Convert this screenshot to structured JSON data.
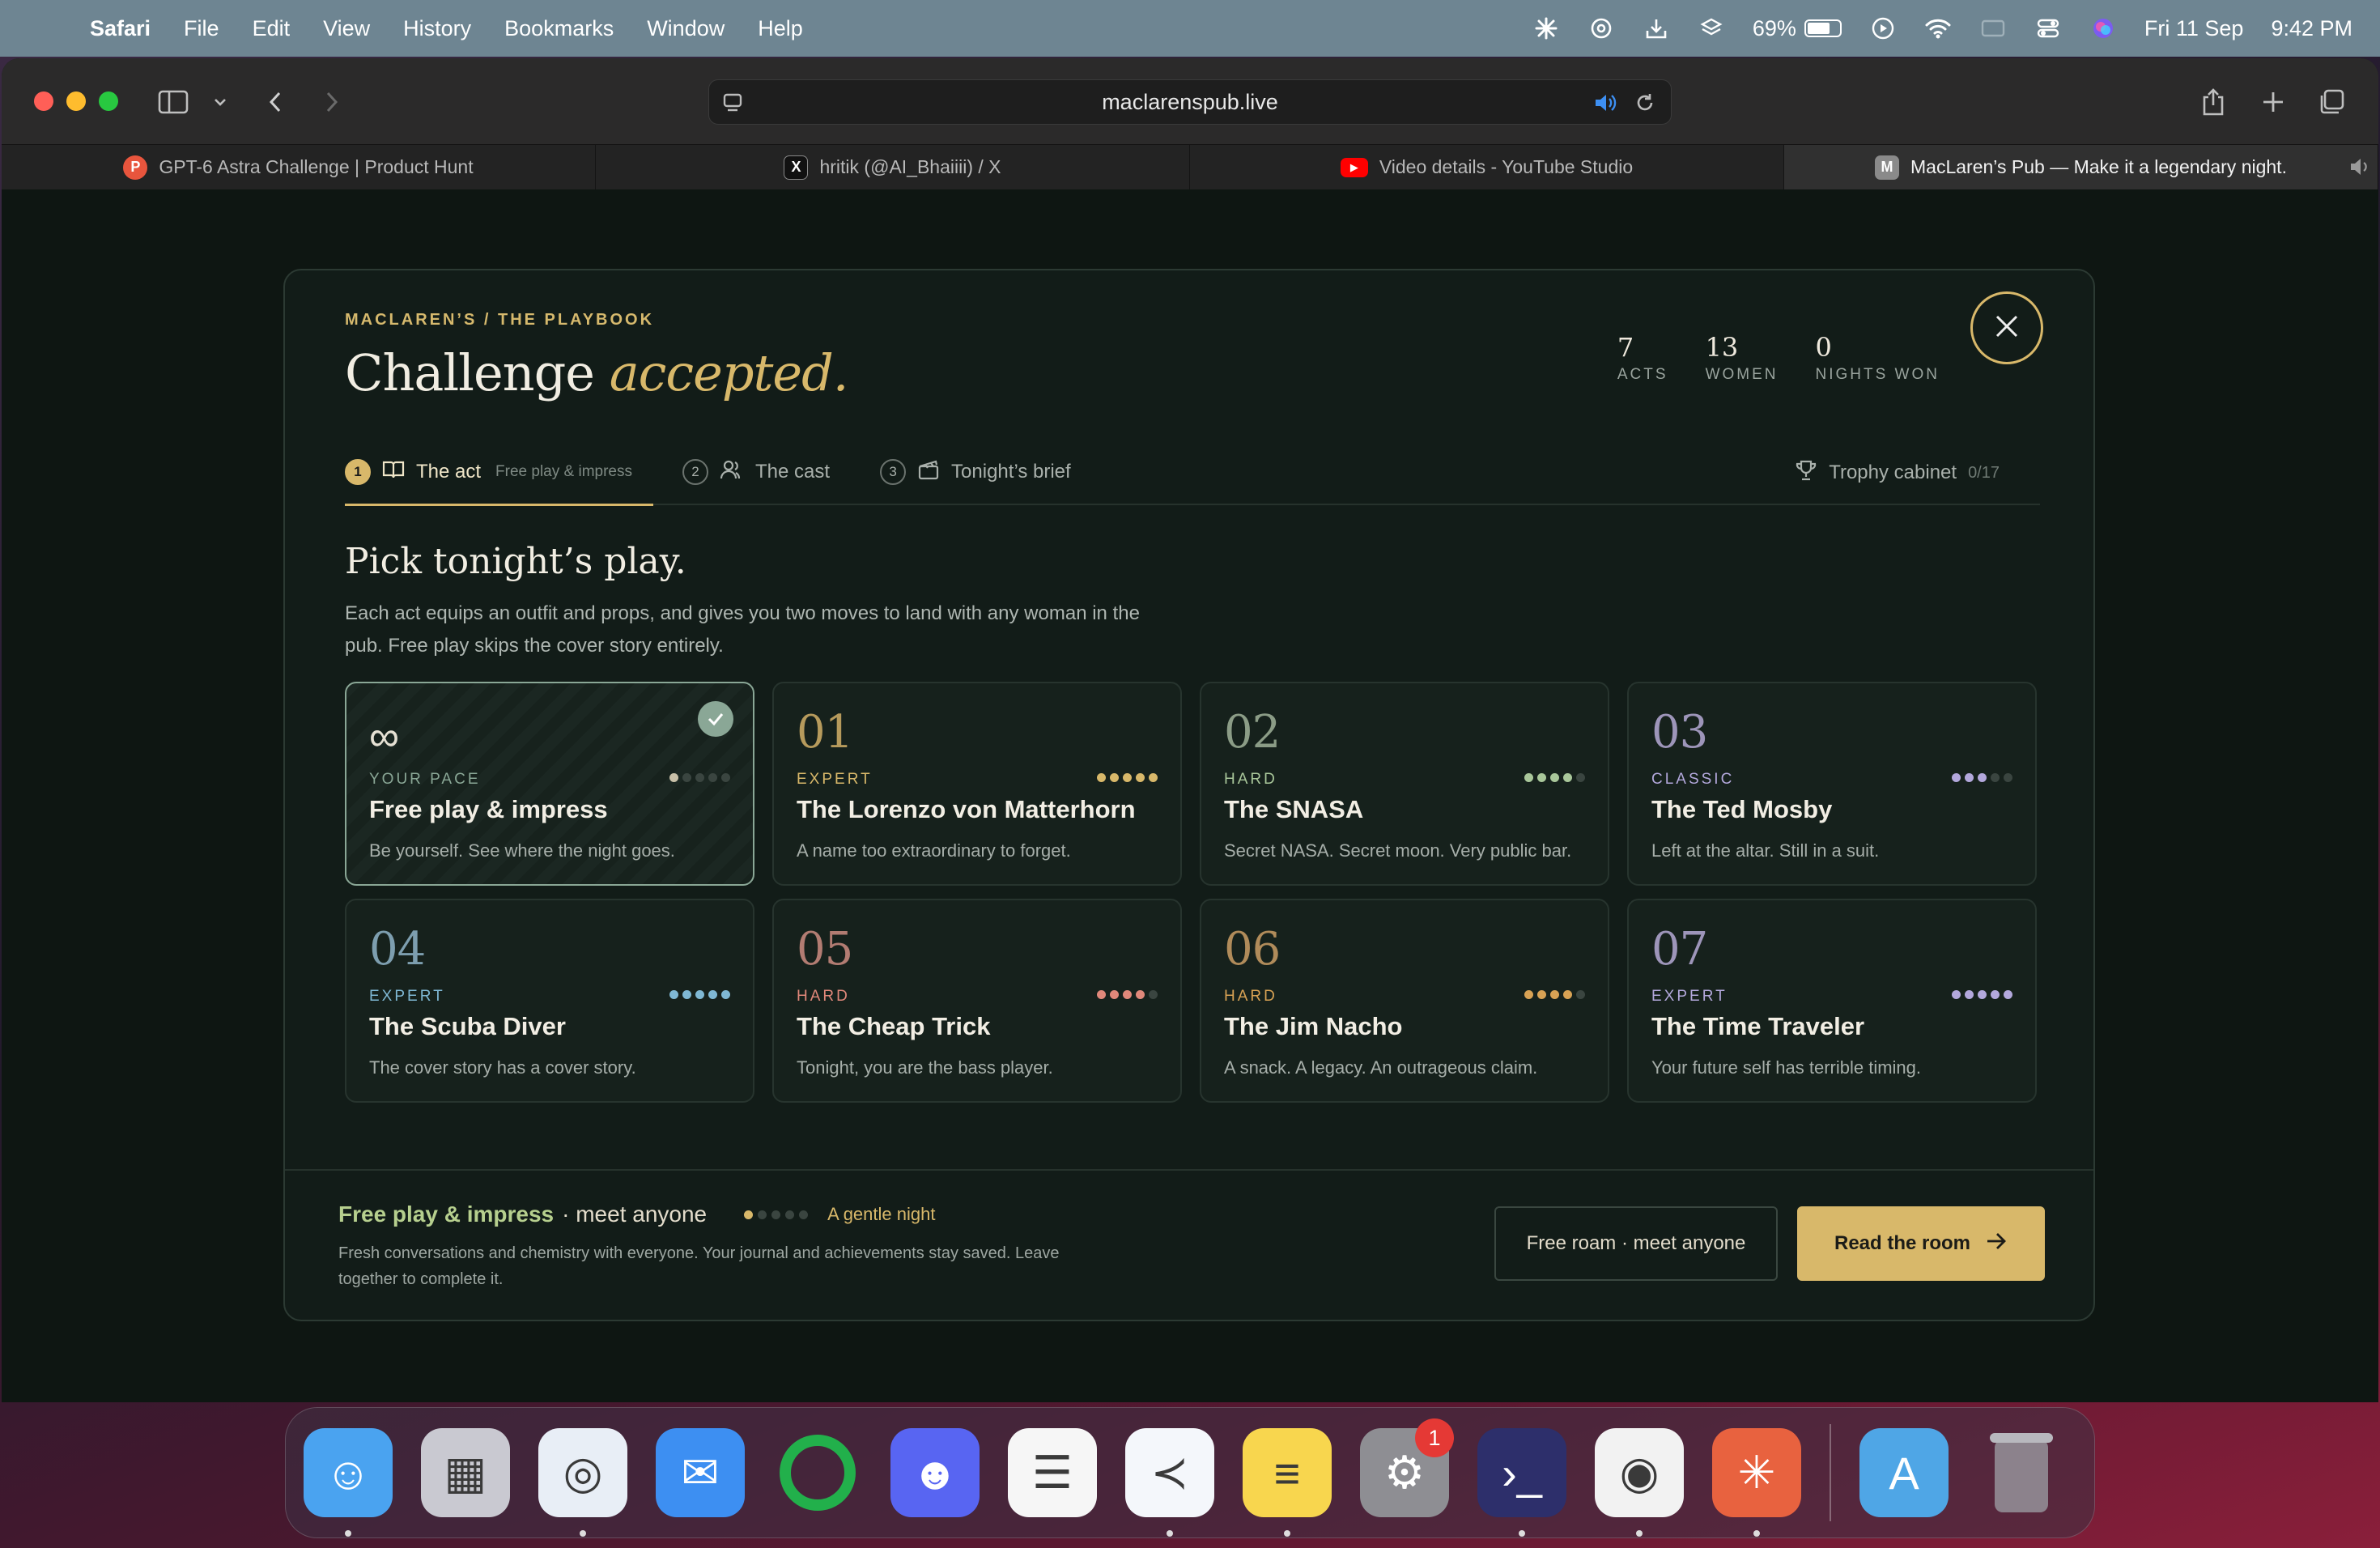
{
  "menubar": {
    "app": "Safari",
    "items": [
      "File",
      "Edit",
      "View",
      "History",
      "Bookmarks",
      "Window",
      "Help"
    ],
    "battery": "69%",
    "date": "Fri 11 Sep",
    "time": "9:42 PM"
  },
  "browser": {
    "url": "maclarenspub.live",
    "tabs": [
      {
        "label": "GPT-6 Astra Challenge | Product Hunt",
        "icon": "producthunt-icon",
        "icon_text": "P",
        "color": "#e8553d"
      },
      {
        "label": "hritik (@AI_Bhaiiii) / X",
        "icon": "x-icon",
        "icon_text": "X",
        "color": "#111111"
      },
      {
        "label": "Video details - YouTube Studio",
        "icon": "youtube-icon",
        "icon_text": "▶",
        "color": "#ff0000"
      },
      {
        "label": "MacLaren’s Pub — Make it a legendary night.",
        "icon": "maclarens-icon",
        "icon_text": "M",
        "color": "#8a8a8a"
      }
    ]
  },
  "modal": {
    "kicker": "MACLAREN’S / THE PLAYBOOK",
    "title_plain": "Challenge",
    "title_em": "accepted.",
    "stats": [
      {
        "value": "7",
        "label": "ACTS"
      },
      {
        "value": "13",
        "label": "WOMEN"
      },
      {
        "value": "0",
        "label": "NIGHTS WON"
      }
    ],
    "steps": [
      {
        "num": "1",
        "label": "The act",
        "sub": "Free play & impress"
      },
      {
        "num": "2",
        "label": "The cast",
        "sub": ""
      },
      {
        "num": "3",
        "label": "Tonight’s brief",
        "sub": ""
      }
    ],
    "trophy": {
      "label": "Trophy cabinet",
      "count": "0/17"
    },
    "heading": "Pick tonight’s play.",
    "description": "Each act equips an outfit and props, and gives you two moves to land with any woman in the pub. Free play skips the cover story entirely.",
    "cards": [
      {
        "num": "∞",
        "difficulty": "YOUR PACE",
        "name": "Free play & impress",
        "desc": "Be yourself. See where the night goes.",
        "level": 1,
        "color": "#8aa796",
        "num_color": "#e6e1d4",
        "selected": true
      },
      {
        "num": "01",
        "difficulty": "EXPERT",
        "name": "The Lorenzo von Matterhorn",
        "desc": "A name too extraordinary to forget.",
        "level": 5,
        "color": "#d8b86a",
        "num_color": "#b69a5c"
      },
      {
        "num": "02",
        "difficulty": "HARD",
        "name": "The SNASA",
        "desc": "Secret NASA. Secret moon. Very public bar.",
        "level": 4,
        "color": "#a9c79a",
        "num_color": "#8b9c86"
      },
      {
        "num": "03",
        "difficulty": "CLASSIC",
        "name": "The Ted Mosby",
        "desc": "Left at the altar. Still in a suit.",
        "level": 3,
        "color": "#b3a8dc",
        "num_color": "#9d95b9"
      },
      {
        "num": "04",
        "difficulty": "EXPERT",
        "name": "The Scuba Diver",
        "desc": "The cover story has a cover story.",
        "level": 5,
        "color": "#7fb8d4",
        "num_color": "#7d9eaf"
      },
      {
        "num": "05",
        "difficulty": "HARD",
        "name": "The Cheap Trick",
        "desc": "Tonight, you are the bass player.",
        "level": 4,
        "color": "#e0887a",
        "num_color": "#b27c72"
      },
      {
        "num": "06",
        "difficulty": "HARD",
        "name": "The Jim Nacho",
        "desc": "A snack. A legacy. An outrageous claim.",
        "level": 4,
        "color": "#d8a254",
        "num_color": "#b08b5a"
      },
      {
        "num": "07",
        "difficulty": "EXPERT",
        "name": "The Time Traveler",
        "desc": "Your future self has terrible timing.",
        "level": 5,
        "color": "#b3a8dc",
        "num_color": "#9d95b9"
      }
    ],
    "footer": {
      "title": "Free play & impress",
      "suffix": "· meet anyone",
      "mood": "A gentle night",
      "level": 1,
      "desc": "Fresh conversations and chemistry with everyone. Your journal and achievements stay saved. Leave together to complete it.",
      "ghost_btn": "Free roam · meet anyone",
      "primary_btn": "Read the room"
    }
  },
  "dock": {
    "apps": [
      {
        "name": "finder-icon",
        "bg": "#4aa3f0",
        "glyph": "☺",
        "running": true
      },
      {
        "name": "launchpad-icon",
        "bg": "#c9c9d1",
        "glyph": "▦",
        "running": false
      },
      {
        "name": "safari-icon",
        "bg": "#e8eef6",
        "glyph": "◎",
        "running": true
      },
      {
        "name": "mail-icon",
        "bg": "#3d8ff2",
        "glyph": "✉",
        "running": false
      },
      {
        "name": "activity-ring-icon",
        "bg": "transparent",
        "glyph": "◯",
        "running": false
      },
      {
        "name": "discord-icon",
        "bg": "#5865f2",
        "glyph": "☻",
        "running": false
      },
      {
        "name": "reminders-icon",
        "bg": "#f6f6f6",
        "glyph": "☰",
        "running": false
      },
      {
        "name": "vscode-icon",
        "bg": "#f4f7fb",
        "glyph": "≺",
        "running": true
      },
      {
        "name": "notes-icon",
        "bg": "#f8d64e",
        "glyph": "≡",
        "running": true
      },
      {
        "name": "system-settings-icon",
        "bg": "#8e8e93",
        "glyph": "⚙",
        "running": false,
        "badge": "1"
      },
      {
        "name": "terminal-app-icon",
        "bg": "#2d2f6b",
        "glyph": "›_",
        "running": true
      },
      {
        "name": "chrome-icon",
        "bg": "#f2f2f2",
        "glyph": "◉",
        "running": true
      },
      {
        "name": "claude-icon",
        "bg": "#e8623f",
        "glyph": "✳",
        "running": true
      },
      {
        "name": "applications-folder-icon",
        "bg": "#4fa6e6",
        "glyph": "A",
        "running": false
      },
      {
        "name": "trash-icon",
        "bg": "transparent",
        "glyph": "🗑",
        "running": false
      }
    ]
  }
}
